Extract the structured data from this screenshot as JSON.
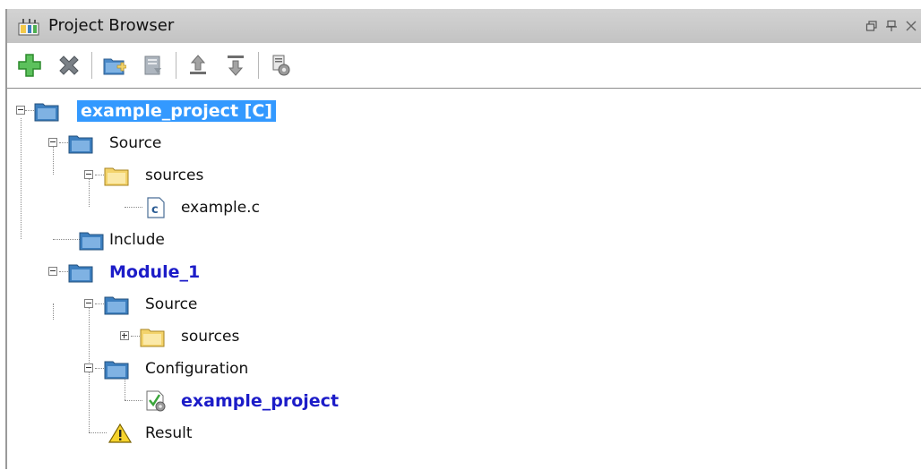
{
  "panel": {
    "title": "Project Browser",
    "title_icon": "project-browser-icon",
    "window_controls": [
      "restore-icon",
      "pin-icon",
      "close-icon"
    ]
  },
  "toolbar": {
    "buttons": [
      {
        "icon": "add-icon",
        "color": "#3aa53a"
      },
      {
        "icon": "remove-icon",
        "color": "#6b7278"
      },
      {
        "icon": "new-folder-icon",
        "color": "#4a89c8"
      },
      {
        "icon": "properties-icon",
        "color": "#9aa3ad"
      },
      {
        "icon": "move-up-icon",
        "color": "#8a8a8a"
      },
      {
        "icon": "move-down-icon",
        "color": "#8a8a8a"
      },
      {
        "icon": "settings-document-icon",
        "color": "#8a8a8a"
      }
    ]
  },
  "tree": {
    "nodes": [
      {
        "label": "example_project [C]",
        "icon": "project-folder-icon",
        "expanded": true,
        "selected": true
      },
      {
        "label": "Source",
        "icon": "folder-icon",
        "expanded": true
      },
      {
        "label": "sources",
        "icon": "open-folder-icon",
        "expanded": true
      },
      {
        "label": "example.c",
        "icon": "c-file-icon"
      },
      {
        "label": "Include",
        "icon": "folder-icon"
      },
      {
        "label": "Module_1",
        "icon": "folder-icon",
        "expanded": true,
        "bold": true
      },
      {
        "label": "Source",
        "icon": "folder-icon",
        "expanded": true
      },
      {
        "label": "sources",
        "icon": "open-folder-icon",
        "expanded": false
      },
      {
        "label": "Configuration",
        "icon": "folder-icon",
        "expanded": true
      },
      {
        "label": "example_project",
        "icon": "configuration-icon",
        "bold": true
      },
      {
        "label": "Result",
        "icon": "warning-icon"
      }
    ]
  },
  "colors": {
    "selection": "#3399ff",
    "bold_link": "#1c1cc8",
    "folder_blue": "#3d7fbf",
    "folder_yellow": "#f3d36b"
  }
}
